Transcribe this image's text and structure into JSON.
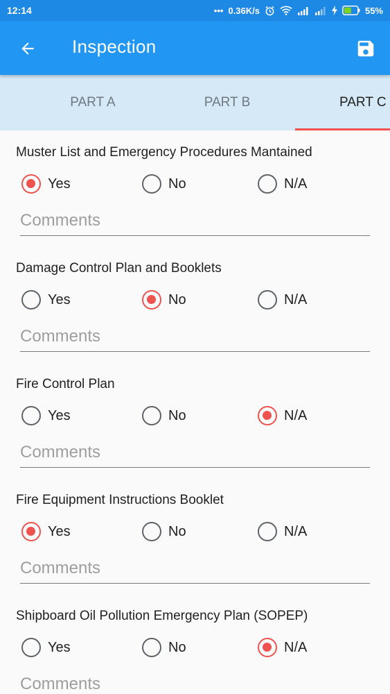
{
  "status_bar": {
    "time": "12:14",
    "dots": "•••",
    "network_speed": "0.36K/s",
    "battery_percent": "55%",
    "icons": [
      "alarm-icon",
      "wifi-icon",
      "signal-icon",
      "signal-icon",
      "charging-icon",
      "battery-icon"
    ]
  },
  "app_bar": {
    "title": "Inspection",
    "back_icon": "arrow-left-icon",
    "save_icon": "save-icon"
  },
  "tabs": [
    {
      "label": "PART A",
      "active": false
    },
    {
      "label": "PART B",
      "active": false
    },
    {
      "label": "PART C",
      "active": true
    }
  ],
  "options": [
    "Yes",
    "No",
    "N/A"
  ],
  "comments_placeholder": "Comments",
  "questions": [
    {
      "text": "Muster List and Emergency Procedures Mantained",
      "selected": "Yes"
    },
    {
      "text": "Damage Control Plan and Booklets",
      "selected": "No"
    },
    {
      "text": "Fire Control Plan",
      "selected": "N/A"
    },
    {
      "text": "Fire Equipment Instructions Booklet",
      "selected": "Yes"
    },
    {
      "text": "Shipboard Oil Pollution Emergency Plan (SOPEP)",
      "selected": "N/A"
    }
  ],
  "colors": {
    "status_bar": "#1e88e5",
    "app_bar": "#2196f3",
    "tab_bar": "#d6e9f7",
    "accent": "#ef5350"
  }
}
